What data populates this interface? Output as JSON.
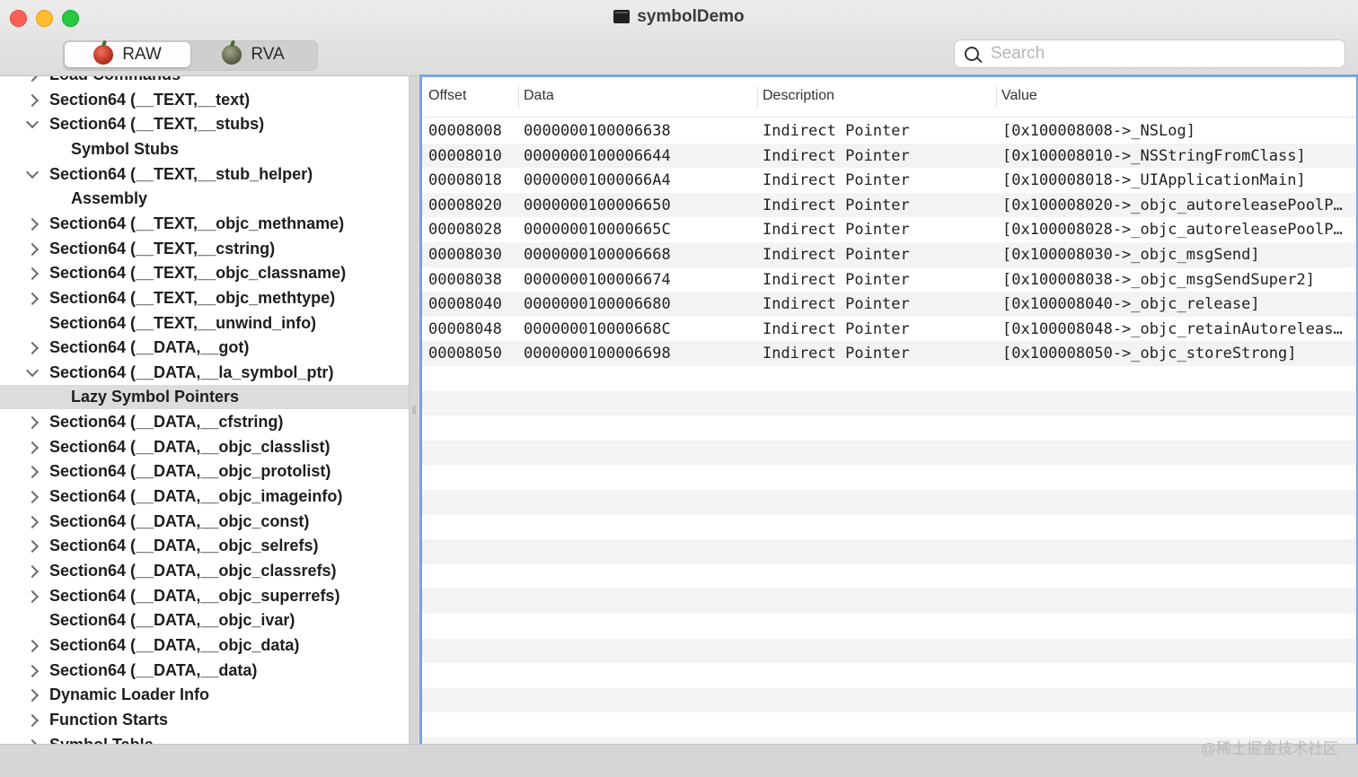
{
  "window": {
    "title": "symbolDemo"
  },
  "toolbar": {
    "segments": [
      {
        "label": "RAW",
        "icon": "apple-red-icon",
        "selected": true
      },
      {
        "label": "RVA",
        "icon": "apple-green-icon",
        "selected": false
      }
    ],
    "search": {
      "placeholder": "Search",
      "value": ""
    }
  },
  "sidebar": {
    "items": [
      {
        "label": "Load Commands",
        "expander": "right",
        "child": false,
        "selected": false
      },
      {
        "label": "Section64 (__TEXT,__text)",
        "expander": "right",
        "child": false,
        "selected": false
      },
      {
        "label": "Section64 (__TEXT,__stubs)",
        "expander": "down",
        "child": false,
        "selected": false
      },
      {
        "label": "Symbol Stubs",
        "expander": "none",
        "child": true,
        "selected": false
      },
      {
        "label": "Section64 (__TEXT,__stub_helper)",
        "expander": "down",
        "child": false,
        "selected": false
      },
      {
        "label": "Assembly",
        "expander": "none",
        "child": true,
        "selected": false
      },
      {
        "label": "Section64 (__TEXT,__objc_methname)",
        "expander": "right",
        "child": false,
        "selected": false
      },
      {
        "label": "Section64 (__TEXT,__cstring)",
        "expander": "right",
        "child": false,
        "selected": false
      },
      {
        "label": "Section64 (__TEXT,__objc_classname)",
        "expander": "right",
        "child": false,
        "selected": false
      },
      {
        "label": "Section64 (__TEXT,__objc_methtype)",
        "expander": "right",
        "child": false,
        "selected": false
      },
      {
        "label": "Section64 (__TEXT,__unwind_info)",
        "expander": "none",
        "child": false,
        "selected": false
      },
      {
        "label": "Section64 (__DATA,__got)",
        "expander": "right",
        "child": false,
        "selected": false
      },
      {
        "label": "Section64 (__DATA,__la_symbol_ptr)",
        "expander": "down",
        "child": false,
        "selected": false
      },
      {
        "label": "Lazy Symbol Pointers",
        "expander": "none",
        "child": true,
        "selected": true
      },
      {
        "label": "Section64 (__DATA,__cfstring)",
        "expander": "right",
        "child": false,
        "selected": false
      },
      {
        "label": "Section64 (__DATA,__objc_classlist)",
        "expander": "right",
        "child": false,
        "selected": false
      },
      {
        "label": "Section64 (__DATA,__objc_protolist)",
        "expander": "right",
        "child": false,
        "selected": false
      },
      {
        "label": "Section64 (__DATA,__objc_imageinfo)",
        "expander": "right",
        "child": false,
        "selected": false
      },
      {
        "label": "Section64 (__DATA,__objc_const)",
        "expander": "right",
        "child": false,
        "selected": false
      },
      {
        "label": "Section64 (__DATA,__objc_selrefs)",
        "expander": "right",
        "child": false,
        "selected": false
      },
      {
        "label": "Section64 (__DATA,__objc_classrefs)",
        "expander": "right",
        "child": false,
        "selected": false
      },
      {
        "label": "Section64 (__DATA,__objc_superrefs)",
        "expander": "right",
        "child": false,
        "selected": false
      },
      {
        "label": "Section64 (__DATA,__objc_ivar)",
        "expander": "none",
        "child": false,
        "selected": false
      },
      {
        "label": "Section64 (__DATA,__objc_data)",
        "expander": "right",
        "child": false,
        "selected": false
      },
      {
        "label": "Section64 (__DATA,__data)",
        "expander": "right",
        "child": false,
        "selected": false
      },
      {
        "label": "Dynamic Loader Info",
        "expander": "right",
        "child": false,
        "selected": false
      },
      {
        "label": "Function Starts",
        "expander": "right",
        "child": false,
        "selected": false
      },
      {
        "label": "Symbol Table",
        "expander": "right",
        "child": false,
        "selected": false
      }
    ]
  },
  "table": {
    "columns": [
      "Offset",
      "Data",
      "Description",
      "Value"
    ],
    "rows": [
      [
        "00008008",
        "0000000100006638",
        "Indirect Pointer",
        "[0x100008008->_NSLog]"
      ],
      [
        "00008010",
        "0000000100006644",
        "Indirect Pointer",
        "[0x100008010->_NSStringFromClass]"
      ],
      [
        "00008018",
        "00000001000066A4",
        "Indirect Pointer",
        "[0x100008018->_UIApplicationMain]"
      ],
      [
        "00008020",
        "0000000100006650",
        "Indirect Pointer",
        "[0x100008020->_objc_autoreleasePoolP…"
      ],
      [
        "00008028",
        "000000010000665C",
        "Indirect Pointer",
        "[0x100008028->_objc_autoreleasePoolP…"
      ],
      [
        "00008030",
        "0000000100006668",
        "Indirect Pointer",
        "[0x100008030->_objc_msgSend]"
      ],
      [
        "00008038",
        "0000000100006674",
        "Indirect Pointer",
        "[0x100008038->_objc_msgSendSuper2]"
      ],
      [
        "00008040",
        "0000000100006680",
        "Indirect Pointer",
        "[0x100008040->_objc_release]"
      ],
      [
        "00008048",
        "000000010000668C",
        "Indirect Pointer",
        "[0x100008048->_objc_retainAutoreleas…"
      ],
      [
        "00008050",
        "0000000100006698",
        "Indirect Pointer",
        "[0x100008050->_objc_storeStrong]"
      ]
    ]
  },
  "watermark": "@稀土掘金技术社区",
  "colors": {
    "selection_border": "#7ba2e3",
    "close": "#fe5f57",
    "minimize": "#febc2e",
    "maximize": "#28c840"
  }
}
